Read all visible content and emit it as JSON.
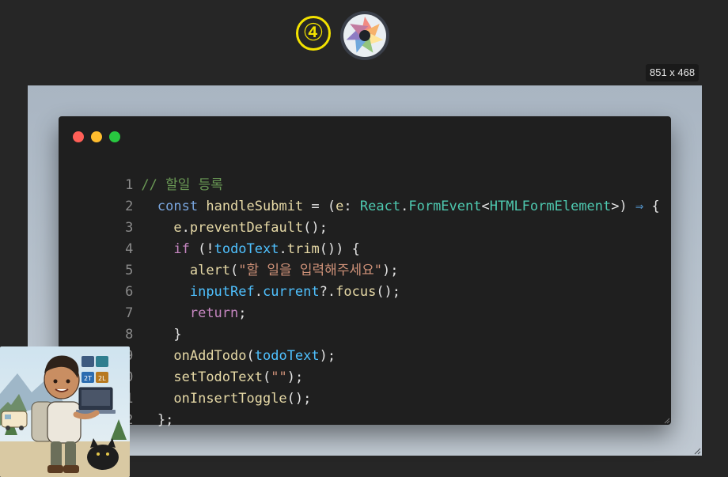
{
  "header": {
    "step_number": "④",
    "logo_icon": "aperture-icon"
  },
  "canvas": {
    "dimensions": "851 x 468"
  },
  "code_window": {
    "controls": [
      "close",
      "minimize",
      "maximize"
    ],
    "line_numbers": [
      "1",
      "2",
      "3",
      "4",
      "5",
      "6",
      "7",
      "8",
      "9",
      "10",
      "11",
      "12"
    ],
    "lines": {
      "l1": {
        "comment": "// 할일 등록"
      },
      "l2": {
        "kw": "const",
        "name": "handleSubmit",
        "eq": "=",
        "paren_open": "(",
        "param": "e",
        "colon": ":",
        "ns": "React",
        "dot": ".",
        "type": "FormEvent",
        "lt": "<",
        "generic": "HTMLFormElement",
        "gt": ">",
        "paren_close": ")",
        "arrow": "⇒",
        "brace": "{"
      },
      "l3": {
        "obj": "e",
        "dot": ".",
        "method": "preventDefault",
        "call": "();"
      },
      "l4": {
        "kw": "if",
        "open": "(!",
        "var": "todoText",
        "dot": ".",
        "method": "trim",
        "close": "())",
        "brace": "{"
      },
      "l5": {
        "fn": "alert",
        "open": "(",
        "str": "\"할 일을 입력해주세요\"",
        "close": ");"
      },
      "l6": {
        "var": "inputRef",
        "dot": ".",
        "prop": "current",
        "opt": "?.",
        "method": "focus",
        "call": "();"
      },
      "l7": {
        "kw": "return",
        "semi": ";"
      },
      "l8": {
        "brace": "}"
      },
      "l9": {
        "fn": "onAddTodo",
        "open": "(",
        "arg": "todoText",
        "close": ");"
      },
      "l10": {
        "fn": "setTodoText",
        "open": "(",
        "str": "\"\"",
        "close": ");"
      },
      "l11": {
        "fn": "onInsertToggle",
        "call": "();"
      },
      "l12": {
        "close": "};"
      }
    }
  },
  "avatar": {
    "icon": "developer-avatar-icon",
    "badges": [
      "2T",
      "2L"
    ]
  },
  "colors": {
    "background": "#262626",
    "canvas": "#b5c0cb",
    "editor": "#1f1f1f",
    "step_accent": "#f3e200"
  }
}
